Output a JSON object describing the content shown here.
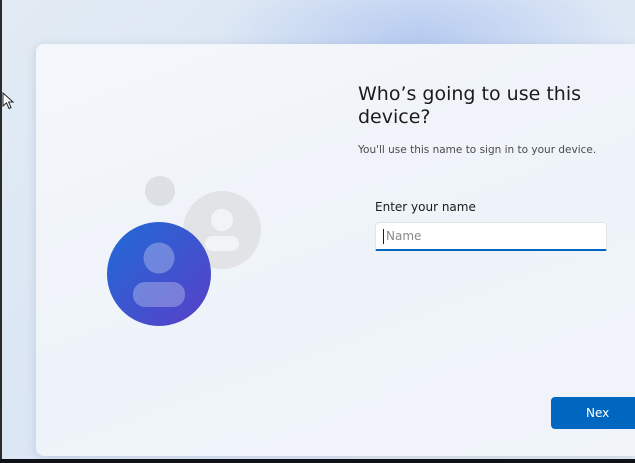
{
  "oobe": {
    "heading": "Who’s going to use this device?",
    "subtext": "You'll use this name to sign in to your device.",
    "name_label": "Enter your name",
    "name_placeholder": "Name",
    "name_value": "",
    "next_label": "Nex"
  },
  "colors": {
    "accent": "#0067c0",
    "avatar_front_start": "#1f6bd6",
    "avatar_front_end": "#5a3fc8"
  },
  "icons": {
    "illustration": "user-avatars-illustration",
    "cursor": "mouse-pointer-icon"
  }
}
